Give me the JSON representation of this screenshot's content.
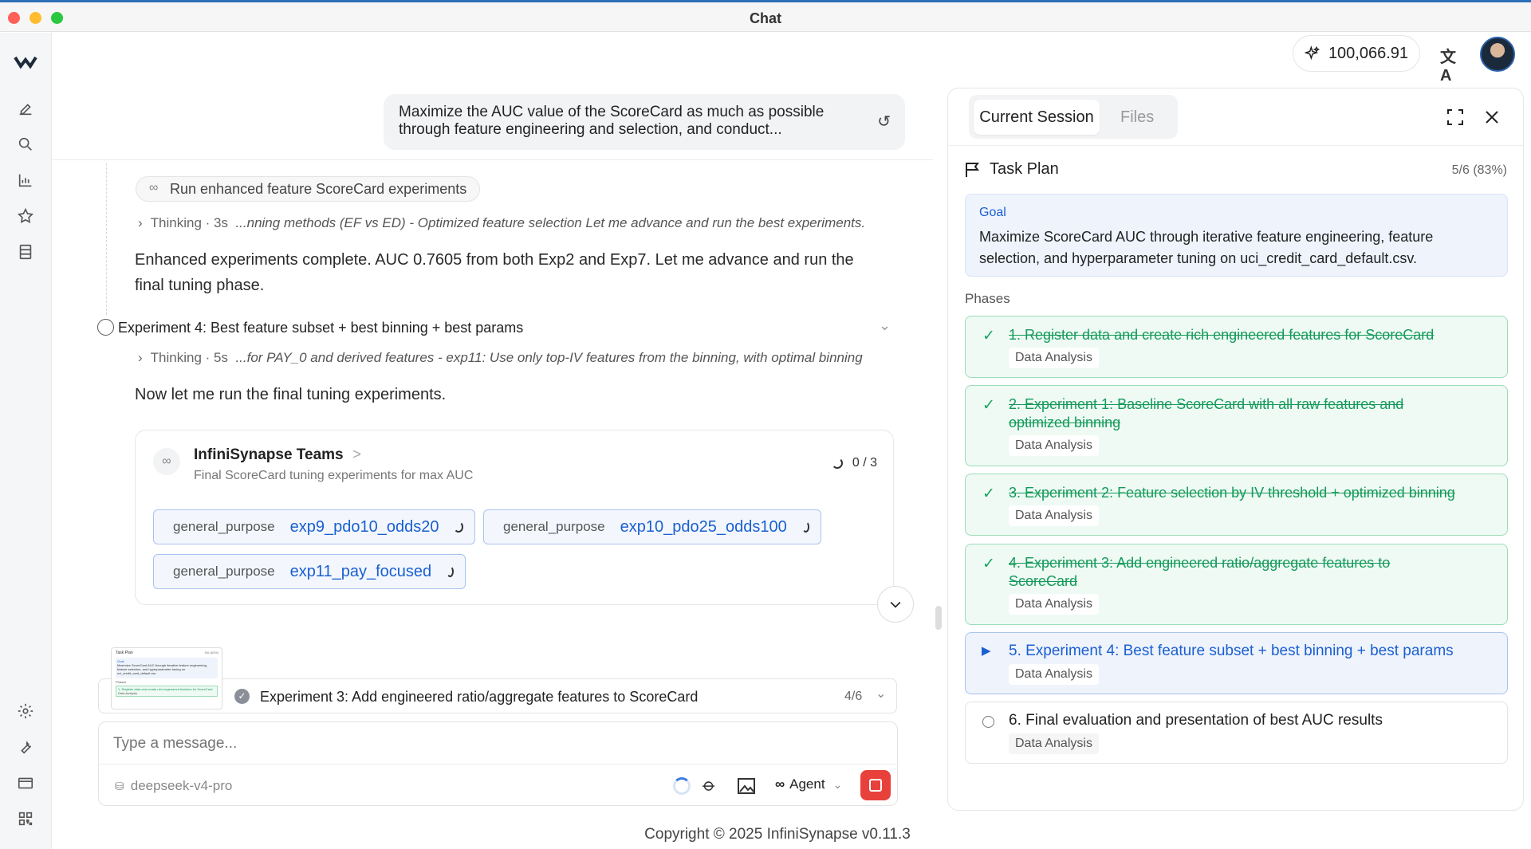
{
  "window": {
    "title": "Chat"
  },
  "topbar": {
    "credits": "100,066.91"
  },
  "chat": {
    "user_message": "Maximize the AUC value of the ScoreCard as much as possible through feature engineering and selection, and conduct...",
    "chip_label": "Run enhanced feature ScoreCard experiments",
    "thinking1_meta": "Thinking · 3s",
    "thinking1_text": "...nning methods (EF vs ED) - Optimized feature selection Let me advance and run the best experiments.",
    "para1_line1": "Enhanced experiments complete. AUC 0.7605 from both Exp2 and Exp7. Let me advance and run the",
    "para1_line2": "final tuning phase.",
    "step_title": "Experiment 4: Best feature subset + best binning + best params",
    "thinking2_meta": "Thinking · 5s",
    "thinking2_text": "...for PAY_0 and derived features - exp11: Use only top-IV features from the binning, with optimal binning",
    "para2": "Now let me run the final tuning experiments.",
    "teams": {
      "title": "InfiniSynapse Teams",
      "arrow": ">",
      "subtitle": "Final ScoreCard tuning experiments for max AUC",
      "progress": "0 / 3",
      "agents": [
        {
          "kind": "general_purpose",
          "name": "exp9_pdo10_odds20"
        },
        {
          "kind": "general_purpose",
          "name": "exp10_pdo25_odds100"
        },
        {
          "kind": "general_purpose",
          "name": "exp11_pay_focused"
        }
      ]
    },
    "plan_bar": {
      "label": "Experiment 3: Add engineered ratio/aggregate features to ScoreCard",
      "count": "4/6"
    },
    "input": {
      "placeholder": "Type a message...",
      "model": "deepseek-v4-pro",
      "mode": "Agent"
    },
    "thumb": {
      "title": "Task Plan",
      "count": "5/6 (83%)",
      "goal": "Goal",
      "goal_text": "Maximize ScoreCard AUC through iterative feature engineering, feature selection, and hyperparameter tuning on uci_credit_card_default.csv",
      "phases": "Phases",
      "phase1": "1. Register data and create rich engineered features for ScoreCard",
      "tag": "Data Analysis"
    }
  },
  "copyright": "Copyright © 2025 InfiniSynapse v0.11.3",
  "panel": {
    "tabs": [
      "Current Session",
      "Files"
    ],
    "plan_title": "Task Plan",
    "progress": "5/6 (83%)",
    "goal_label": "Goal",
    "goal_line1": "Maximize ScoreCard AUC through iterative feature engineering, feature",
    "goal_line2": "selection, and hyperparameter tuning on uci_credit_card_default.csv.",
    "phases_label": "Phases",
    "phases": [
      {
        "l1": "1. Register data and create rich engineered features for ScoreCard",
        "l2": "",
        "tag": "Data Analysis",
        "status": "done"
      },
      {
        "l1": "2. Experiment 1: Baseline ScoreCard with all raw features and",
        "l2": "optimized binning",
        "tag": "Data Analysis",
        "status": "done"
      },
      {
        "l1": "3. Experiment 2: Feature selection by IV threshold + optimized binning",
        "l2": "",
        "tag": "Data Analysis",
        "status": "done"
      },
      {
        "l1": "4. Experiment 3: Add engineered ratio/aggregate features to",
        "l2": "ScoreCard",
        "tag": "Data Analysis",
        "status": "done"
      },
      {
        "l1": "5. Experiment 4: Best feature subset + best binning + best params",
        "l2": "",
        "tag": "Data Analysis",
        "status": "active"
      },
      {
        "l1": "6. Final evaluation and presentation of best AUC results",
        "l2": "",
        "tag": "Data Analysis",
        "status": "pending"
      }
    ]
  }
}
